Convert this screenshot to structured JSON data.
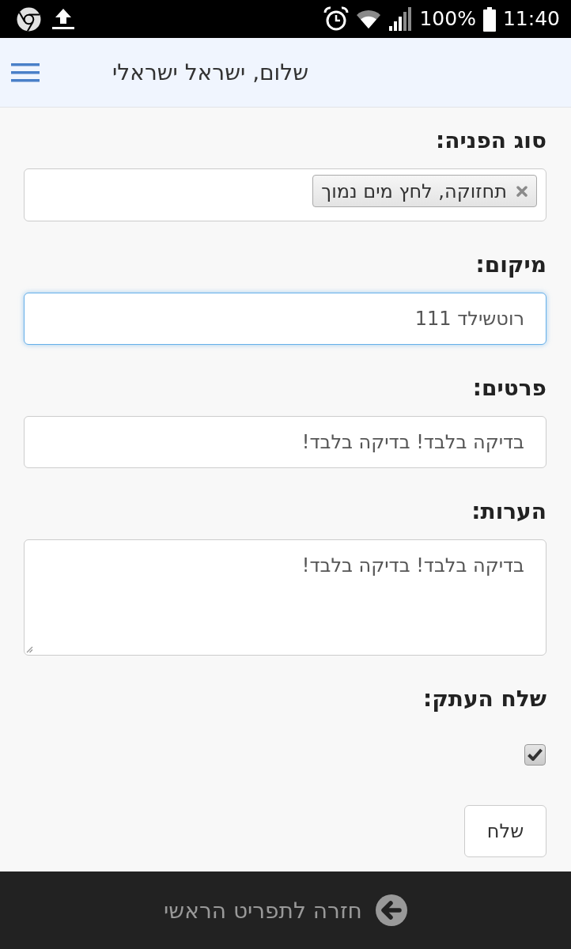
{
  "status_bar": {
    "battery_text": "100%",
    "time": "11:40"
  },
  "header": {
    "greeting": "שלום, ישראל ישראלי"
  },
  "form": {
    "fields": [
      {
        "kind": "tags",
        "label": "סוג הפניה:",
        "tags": [
          "תחזוקה, לחץ מים נמוך"
        ]
      },
      {
        "kind": "input",
        "label": "מיקום:",
        "value": "רוטשילד 111",
        "focused": true
      },
      {
        "kind": "input",
        "label": "פרטים:",
        "value": "בדיקה בלבד! בדיקה בלבד!",
        "focused": false
      },
      {
        "kind": "textarea",
        "label": "הערות:",
        "value": "בדיקה בלבד! בדיקה בלבד!",
        "focused": false
      },
      {
        "kind": "checkbox",
        "label": "שלח העתק:",
        "checked": true
      }
    ],
    "submit_button": "שלח"
  },
  "footer": {
    "back_link": "חזרה לתפריט הראשי"
  }
}
